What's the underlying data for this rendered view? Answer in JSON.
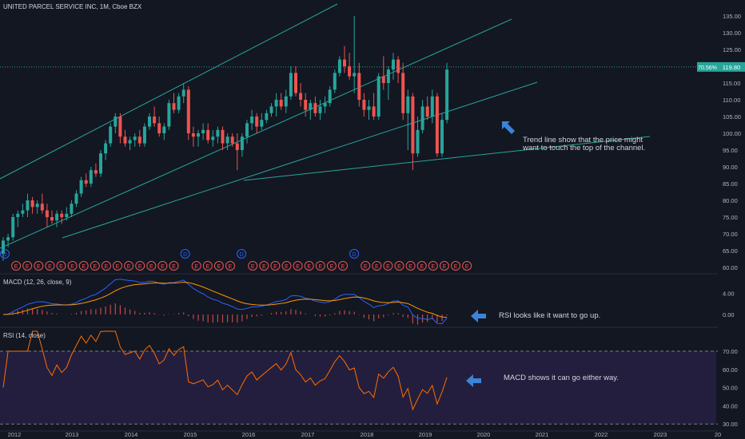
{
  "chart_data": {
    "type": "candlestick",
    "title": "UNITED PARCEL SERVICE INC, 1M, Cboe BZX",
    "price_axis": {
      "ticks": [
        60,
        65,
        70,
        75,
        80,
        85,
        90,
        95,
        100,
        105,
        110,
        115,
        120,
        125,
        130,
        135
      ],
      "tick_labels": [
        "60.00",
        "65.00",
        "70.00",
        "75.00",
        "80.00",
        "85.00",
        "90.00",
        "95.00",
        "100.00",
        "105.00",
        "110.00",
        "115.00",
        "120.00",
        "125.00",
        "130.00",
        "135.00"
      ]
    },
    "x_axis": {
      "ticks": [
        "2012",
        "2013",
        "2014",
        "2015",
        "2016",
        "2017",
        "2018",
        "2019",
        "2020",
        "2021",
        "2022",
        "2023",
        "20"
      ]
    },
    "last_price": {
      "label": "119.80",
      "change_label": "70.56%",
      "value": 119.8
    },
    "candles": [
      [
        64,
        69,
        62,
        68
      ],
      [
        68,
        70,
        66,
        69
      ],
      [
        69,
        76,
        68,
        75
      ],
      [
        75,
        77,
        72,
        76
      ],
      [
        76,
        79,
        75,
        77
      ],
      [
        77,
        82,
        75,
        80
      ],
      [
        80,
        81,
        76,
        78
      ],
      [
        78,
        80,
        76,
        79
      ],
      [
        79,
        82,
        76,
        77
      ],
      [
        77,
        79,
        72,
        75
      ],
      [
        75,
        77,
        73,
        74
      ],
      [
        74,
        77,
        72,
        76
      ],
      [
        76,
        77,
        73,
        75
      ],
      [
        75,
        78,
        74,
        76
      ],
      [
        76,
        80,
        75,
        79
      ],
      [
        79,
        83,
        78,
        82
      ],
      [
        82,
        87,
        81,
        86
      ],
      [
        86,
        88,
        84,
        85
      ],
      [
        85,
        90,
        84,
        89
      ],
      [
        89,
        91,
        87,
        88
      ],
      [
        88,
        95,
        87,
        94
      ],
      [
        94,
        98,
        92,
        97
      ],
      [
        97,
        103,
        96,
        102
      ],
      [
        102,
        106,
        100,
        105
      ],
      [
        105,
        106,
        97,
        99
      ],
      [
        99,
        101,
        96,
        97
      ],
      [
        97,
        99,
        95,
        98
      ],
      [
        98,
        100,
        96,
        99
      ],
      [
        99,
        101,
        96,
        97
      ],
      [
        97,
        103,
        96,
        102
      ],
      [
        102,
        106,
        101,
        105
      ],
      [
        105,
        108,
        102,
        103
      ],
      [
        103,
        105,
        99,
        100
      ],
      [
        100,
        103,
        98,
        102
      ],
      [
        102,
        110,
        101,
        109
      ],
      [
        109,
        112,
        106,
        107
      ],
      [
        107,
        112,
        106,
        111
      ],
      [
        111,
        115,
        109,
        113
      ],
      [
        113,
        114,
        98,
        100
      ],
      [
        100,
        102,
        96,
        99
      ],
      [
        99,
        101,
        96,
        100
      ],
      [
        100,
        103,
        98,
        101
      ],
      [
        101,
        103,
        97,
        98
      ],
      [
        98,
        101,
        96,
        99
      ],
      [
        99,
        102,
        97,
        101
      ],
      [
        101,
        102,
        95,
        97
      ],
      [
        97,
        100,
        95,
        99
      ],
      [
        99,
        100,
        96,
        97
      ],
      [
        97,
        100,
        89,
        95
      ],
      [
        95,
        100,
        93,
        99
      ],
      [
        99,
        104,
        97,
        103
      ],
      [
        103,
        107,
        101,
        105
      ],
      [
        105,
        106,
        100,
        102
      ],
      [
        102,
        106,
        101,
        104
      ],
      [
        104,
        107,
        103,
        106
      ],
      [
        106,
        109,
        105,
        108
      ],
      [
        108,
        112,
        105,
        110
      ],
      [
        110,
        112,
        107,
        108
      ],
      [
        108,
        113,
        106,
        111
      ],
      [
        111,
        120,
        110,
        118
      ],
      [
        118,
        120,
        111,
        112
      ],
      [
        112,
        115,
        108,
        110
      ],
      [
        110,
        112,
        105,
        107
      ],
      [
        107,
        110,
        104,
        109
      ],
      [
        109,
        111,
        105,
        106
      ],
      [
        106,
        110,
        104,
        108
      ],
      [
        108,
        111,
        106,
        109
      ],
      [
        109,
        114,
        108,
        113
      ],
      [
        113,
        119,
        112,
        118
      ],
      [
        118,
        123,
        117,
        122
      ],
      [
        122,
        126,
        118,
        120
      ],
      [
        120,
        124,
        116,
        117
      ],
      [
        117,
        135,
        112,
        118
      ],
      [
        118,
        121,
        108,
        110
      ],
      [
        110,
        112,
        105,
        107
      ],
      [
        107,
        110,
        104,
        108
      ],
      [
        108,
        112,
        104,
        105
      ],
      [
        105,
        118,
        104,
        117
      ],
      [
        117,
        123,
        113,
        115
      ],
      [
        115,
        120,
        110,
        119
      ],
      [
        119,
        124,
        116,
        122
      ],
      [
        122,
        123,
        115,
        118
      ],
      [
        118,
        121,
        104,
        106
      ],
      [
        106,
        113,
        95,
        111
      ],
      [
        111,
        112,
        89,
        94
      ],
      [
        94,
        105,
        93,
        101
      ],
      [
        101,
        110,
        100,
        108
      ],
      [
        108,
        111,
        104,
        105
      ],
      [
        105,
        113,
        103,
        111
      ],
      [
        111,
        112,
        93,
        94
      ],
      [
        94,
        106,
        93,
        104
      ],
      [
        104,
        121,
        103,
        119
      ]
    ],
    "macd": {
      "label": "MACD (12, 26, close, 9)",
      "ticks": [
        0,
        4
      ],
      "tick_labels": [
        "0.00",
        "4.00"
      ]
    },
    "rsi": {
      "label": "RSI (14, close)",
      "ticks": [
        30,
        40,
        50,
        60,
        70
      ],
      "tick_labels": [
        "30.00",
        "40.00",
        "50.00",
        "60.00",
        "70.00"
      ],
      "upper_band": 70,
      "lower_band": 30
    },
    "events": [
      {
        "type": "D"
      },
      {
        "type": "E"
      },
      {
        "type": "E"
      },
      {
        "type": "E"
      },
      {
        "type": "E"
      },
      {
        "type": "E"
      },
      {
        "type": "E"
      },
      {
        "type": "E"
      },
      {
        "type": "E"
      },
      {
        "type": "E"
      },
      {
        "type": "E"
      },
      {
        "type": "E"
      },
      {
        "type": "E"
      },
      {
        "type": "E"
      },
      {
        "type": "E"
      },
      {
        "type": "E"
      },
      {
        "type": "D"
      },
      {
        "type": "E"
      },
      {
        "type": "E"
      },
      {
        "type": "E"
      },
      {
        "type": "E"
      },
      {
        "type": "D"
      },
      {
        "type": "E"
      },
      {
        "type": "E"
      },
      {
        "type": "E"
      },
      {
        "type": "E"
      },
      {
        "type": "E"
      },
      {
        "type": "E"
      },
      {
        "type": "E"
      },
      {
        "type": "E"
      },
      {
        "type": "E"
      },
      {
        "type": "D"
      },
      {
        "type": "E"
      },
      {
        "type": "E"
      },
      {
        "type": "E"
      },
      {
        "type": "E"
      },
      {
        "type": "E"
      },
      {
        "type": "E"
      },
      {
        "type": "E"
      },
      {
        "type": "E"
      },
      {
        "type": "E"
      },
      {
        "type": "E"
      }
    ],
    "annotations": [
      "Trend line show that the price might want to touch the top of the channel.",
      "RSI looks like it want to go up.",
      "MACD shows it can go either way."
    ]
  },
  "colors": {
    "up": "#26a69a",
    "down": "#ef5350",
    "trend": "#26a69a",
    "macd": "#2962ff",
    "signal": "#ff9800",
    "rsi": "#ff6d00",
    "arrow": "#3c84d6",
    "rsi_band": "#2a2147"
  }
}
